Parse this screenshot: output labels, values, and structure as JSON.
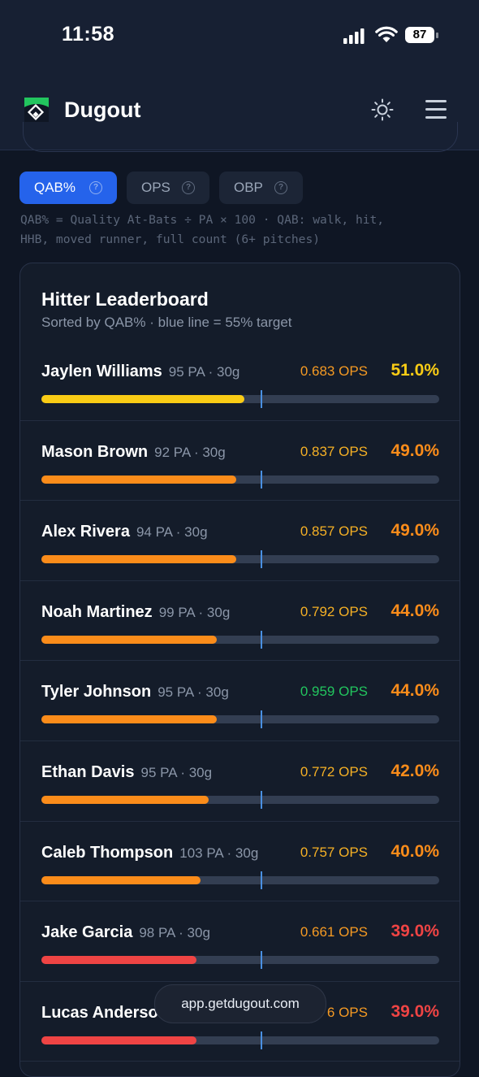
{
  "status_bar": {
    "time": "11:58",
    "battery": "87"
  },
  "header": {
    "brand": "Dugout"
  },
  "tabs": [
    {
      "label": "QAB%",
      "active": true
    },
    {
      "label": "OPS",
      "active": false
    },
    {
      "label": "OBP",
      "active": false
    }
  ],
  "description": "QAB% = Quality At-Bats ÷ PA × 100 · QAB: walk, hit,\nHHB, moved runner, full count (6+ pitches)",
  "leaderboard": {
    "title": "Hitter Leaderboard",
    "subtitle": "Sorted by QAB% · blue line = 55% target",
    "target_pct": 55,
    "rows": [
      {
        "name": "Jaylen Williams",
        "meta": "95 PA · 30g",
        "ops": "0.683 OPS",
        "ops_color": "#f59a23",
        "qab": "51.0%",
        "qab_value": 51.0,
        "qab_color": "#facc15"
      },
      {
        "name": "Mason Brown",
        "meta": "92 PA · 30g",
        "ops": "0.837 OPS",
        "ops_color": "#f5b025",
        "qab": "49.0%",
        "qab_value": 49.0,
        "qab_color": "#fb8c1a"
      },
      {
        "name": "Alex Rivera",
        "meta": "94 PA · 30g",
        "ops": "0.857 OPS",
        "ops_color": "#f5b025",
        "qab": "49.0%",
        "qab_value": 49.0,
        "qab_color": "#fb8c1a"
      },
      {
        "name": "Noah Martinez",
        "meta": "99 PA · 30g",
        "ops": "0.792 OPS",
        "ops_color": "#f5b025",
        "qab": "44.0%",
        "qab_value": 44.0,
        "qab_color": "#fb8c1a"
      },
      {
        "name": "Tyler Johnson",
        "meta": "95 PA · 30g",
        "ops": "0.959 OPS",
        "ops_color": "#22c55e",
        "qab": "44.0%",
        "qab_value": 44.0,
        "qab_color": "#fb8c1a"
      },
      {
        "name": "Ethan Davis",
        "meta": "95 PA · 30g",
        "ops": "0.772 OPS",
        "ops_color": "#f5b025",
        "qab": "42.0%",
        "qab_value": 42.0,
        "qab_color": "#fb8c1a"
      },
      {
        "name": "Caleb Thompson",
        "meta": "103 PA · 30g",
        "ops": "0.757 OPS",
        "ops_color": "#f5b025",
        "qab": "40.0%",
        "qab_value": 40.0,
        "qab_color": "#fb8c1a"
      },
      {
        "name": "Jake Garcia",
        "meta": "98 PA · 30g",
        "ops": "0.661 OPS",
        "ops_color": "#f59a23",
        "qab": "39.0%",
        "qab_value": 39.0,
        "qab_color": "#ef4444"
      },
      {
        "name": "Lucas Anderso",
        "meta": "",
        "ops": "6 OPS",
        "ops_color": "#f59a23",
        "qab": "39.0%",
        "qab_value": 39.0,
        "qab_color": "#ef4444"
      }
    ]
  },
  "url_bar": {
    "url": "app.getdugout.com"
  }
}
